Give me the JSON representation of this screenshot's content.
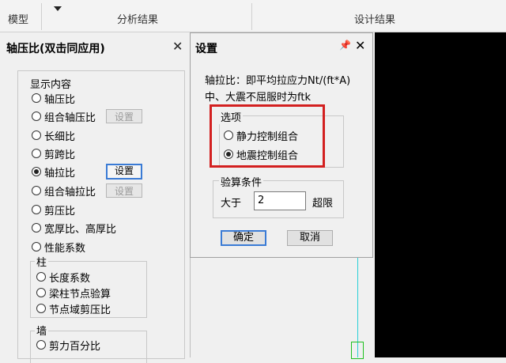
{
  "ribbon": {
    "tab_model": "模型",
    "tab_analysis": "分析结果",
    "tab_design": "设计结果"
  },
  "left_panel": {
    "title": "轴压比(双击同应用)",
    "group_label": "显示内容",
    "items": [
      {
        "label": "轴压比",
        "selected": false
      },
      {
        "label": "组合轴压比",
        "selected": false,
        "button": "设置",
        "button_enabled": false
      },
      {
        "label": "长细比",
        "selected": false
      },
      {
        "label": "剪跨比",
        "selected": false
      },
      {
        "label": "轴拉比",
        "selected": true,
        "button": "设置",
        "button_enabled": true
      },
      {
        "label": "组合轴拉比",
        "selected": false,
        "button": "设置",
        "button_enabled": false
      },
      {
        "label": "剪压比",
        "selected": false
      },
      {
        "label": "宽厚比、高厚比",
        "selected": false
      },
      {
        "label": "性能系数",
        "selected": false
      }
    ],
    "column_group": {
      "label": "柱",
      "items": [
        "长度系数",
        "梁柱节点验算",
        "节点域剪压比"
      ]
    },
    "wall_group": {
      "label": "墙",
      "items": [
        "剪力百分比"
      ]
    }
  },
  "dialog": {
    "title": "设置",
    "pin_icon": "pin-icon",
    "close_icon": "close-icon",
    "description_line1": "轴拉比：即平均拉应力Nt/(ft*A)",
    "description_line2": "中、大震不屈服时为ftk",
    "options_label": "选项",
    "options": [
      {
        "label": "静力控制组合",
        "selected": false
      },
      {
        "label": "地震控制组合",
        "selected": true
      }
    ],
    "check_label": "验算条件",
    "greater_than_label": "大于",
    "threshold_value": "2",
    "exceed_label": "超限",
    "ok_label": "确定",
    "cancel_label": "取消"
  },
  "colors": {
    "highlight_red": "#d32020",
    "focus_blue": "#3a7bd5",
    "canvas": "#000000",
    "cyan_line": "#28d0d8",
    "green_rect": "#20c020"
  }
}
